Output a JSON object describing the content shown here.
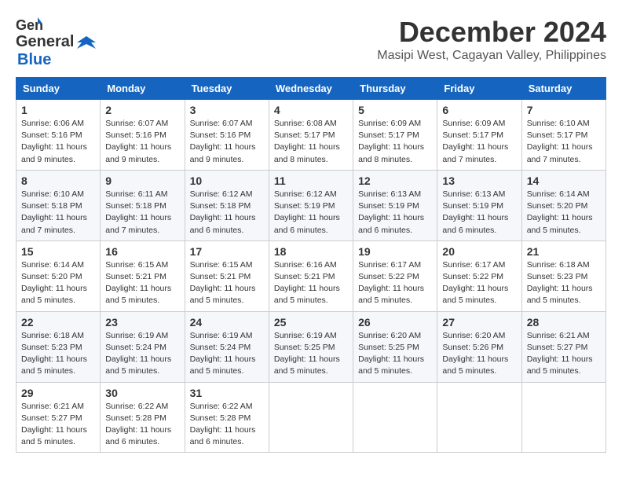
{
  "logo": {
    "general": "General",
    "blue": "Blue"
  },
  "title": {
    "month": "December 2024",
    "location": "Masipi West, Cagayan Valley, Philippines"
  },
  "weekdays": [
    "Sunday",
    "Monday",
    "Tuesday",
    "Wednesday",
    "Thursday",
    "Friday",
    "Saturday"
  ],
  "weeks": [
    [
      {
        "day": "1",
        "sunrise": "Sunrise: 6:06 AM",
        "sunset": "Sunset: 5:16 PM",
        "daylight": "Daylight: 11 hours and 9 minutes."
      },
      {
        "day": "2",
        "sunrise": "Sunrise: 6:07 AM",
        "sunset": "Sunset: 5:16 PM",
        "daylight": "Daylight: 11 hours and 9 minutes."
      },
      {
        "day": "3",
        "sunrise": "Sunrise: 6:07 AM",
        "sunset": "Sunset: 5:16 PM",
        "daylight": "Daylight: 11 hours and 9 minutes."
      },
      {
        "day": "4",
        "sunrise": "Sunrise: 6:08 AM",
        "sunset": "Sunset: 5:17 PM",
        "daylight": "Daylight: 11 hours and 8 minutes."
      },
      {
        "day": "5",
        "sunrise": "Sunrise: 6:09 AM",
        "sunset": "Sunset: 5:17 PM",
        "daylight": "Daylight: 11 hours and 8 minutes."
      },
      {
        "day": "6",
        "sunrise": "Sunrise: 6:09 AM",
        "sunset": "Sunset: 5:17 PM",
        "daylight": "Daylight: 11 hours and 7 minutes."
      },
      {
        "day": "7",
        "sunrise": "Sunrise: 6:10 AM",
        "sunset": "Sunset: 5:17 PM",
        "daylight": "Daylight: 11 hours and 7 minutes."
      }
    ],
    [
      {
        "day": "8",
        "sunrise": "Sunrise: 6:10 AM",
        "sunset": "Sunset: 5:18 PM",
        "daylight": "Daylight: 11 hours and 7 minutes."
      },
      {
        "day": "9",
        "sunrise": "Sunrise: 6:11 AM",
        "sunset": "Sunset: 5:18 PM",
        "daylight": "Daylight: 11 hours and 7 minutes."
      },
      {
        "day": "10",
        "sunrise": "Sunrise: 6:12 AM",
        "sunset": "Sunset: 5:18 PM",
        "daylight": "Daylight: 11 hours and 6 minutes."
      },
      {
        "day": "11",
        "sunrise": "Sunrise: 6:12 AM",
        "sunset": "Sunset: 5:19 PM",
        "daylight": "Daylight: 11 hours and 6 minutes."
      },
      {
        "day": "12",
        "sunrise": "Sunrise: 6:13 AM",
        "sunset": "Sunset: 5:19 PM",
        "daylight": "Daylight: 11 hours and 6 minutes."
      },
      {
        "day": "13",
        "sunrise": "Sunrise: 6:13 AM",
        "sunset": "Sunset: 5:19 PM",
        "daylight": "Daylight: 11 hours and 6 minutes."
      },
      {
        "day": "14",
        "sunrise": "Sunrise: 6:14 AM",
        "sunset": "Sunset: 5:20 PM",
        "daylight": "Daylight: 11 hours and 5 minutes."
      }
    ],
    [
      {
        "day": "15",
        "sunrise": "Sunrise: 6:14 AM",
        "sunset": "Sunset: 5:20 PM",
        "daylight": "Daylight: 11 hours and 5 minutes."
      },
      {
        "day": "16",
        "sunrise": "Sunrise: 6:15 AM",
        "sunset": "Sunset: 5:21 PM",
        "daylight": "Daylight: 11 hours and 5 minutes."
      },
      {
        "day": "17",
        "sunrise": "Sunrise: 6:15 AM",
        "sunset": "Sunset: 5:21 PM",
        "daylight": "Daylight: 11 hours and 5 minutes."
      },
      {
        "day": "18",
        "sunrise": "Sunrise: 6:16 AM",
        "sunset": "Sunset: 5:21 PM",
        "daylight": "Daylight: 11 hours and 5 minutes."
      },
      {
        "day": "19",
        "sunrise": "Sunrise: 6:17 AM",
        "sunset": "Sunset: 5:22 PM",
        "daylight": "Daylight: 11 hours and 5 minutes."
      },
      {
        "day": "20",
        "sunrise": "Sunrise: 6:17 AM",
        "sunset": "Sunset: 5:22 PM",
        "daylight": "Daylight: 11 hours and 5 minutes."
      },
      {
        "day": "21",
        "sunrise": "Sunrise: 6:18 AM",
        "sunset": "Sunset: 5:23 PM",
        "daylight": "Daylight: 11 hours and 5 minutes."
      }
    ],
    [
      {
        "day": "22",
        "sunrise": "Sunrise: 6:18 AM",
        "sunset": "Sunset: 5:23 PM",
        "daylight": "Daylight: 11 hours and 5 minutes."
      },
      {
        "day": "23",
        "sunrise": "Sunrise: 6:19 AM",
        "sunset": "Sunset: 5:24 PM",
        "daylight": "Daylight: 11 hours and 5 minutes."
      },
      {
        "day": "24",
        "sunrise": "Sunrise: 6:19 AM",
        "sunset": "Sunset: 5:24 PM",
        "daylight": "Daylight: 11 hours and 5 minutes."
      },
      {
        "day": "25",
        "sunrise": "Sunrise: 6:19 AM",
        "sunset": "Sunset: 5:25 PM",
        "daylight": "Daylight: 11 hours and 5 minutes."
      },
      {
        "day": "26",
        "sunrise": "Sunrise: 6:20 AM",
        "sunset": "Sunset: 5:25 PM",
        "daylight": "Daylight: 11 hours and 5 minutes."
      },
      {
        "day": "27",
        "sunrise": "Sunrise: 6:20 AM",
        "sunset": "Sunset: 5:26 PM",
        "daylight": "Daylight: 11 hours and 5 minutes."
      },
      {
        "day": "28",
        "sunrise": "Sunrise: 6:21 AM",
        "sunset": "Sunset: 5:27 PM",
        "daylight": "Daylight: 11 hours and 5 minutes."
      }
    ],
    [
      {
        "day": "29",
        "sunrise": "Sunrise: 6:21 AM",
        "sunset": "Sunset: 5:27 PM",
        "daylight": "Daylight: 11 hours and 5 minutes."
      },
      {
        "day": "30",
        "sunrise": "Sunrise: 6:22 AM",
        "sunset": "Sunset: 5:28 PM",
        "daylight": "Daylight: 11 hours and 6 minutes."
      },
      {
        "day": "31",
        "sunrise": "Sunrise: 6:22 AM",
        "sunset": "Sunset: 5:28 PM",
        "daylight": "Daylight: 11 hours and 6 minutes."
      },
      null,
      null,
      null,
      null
    ]
  ]
}
